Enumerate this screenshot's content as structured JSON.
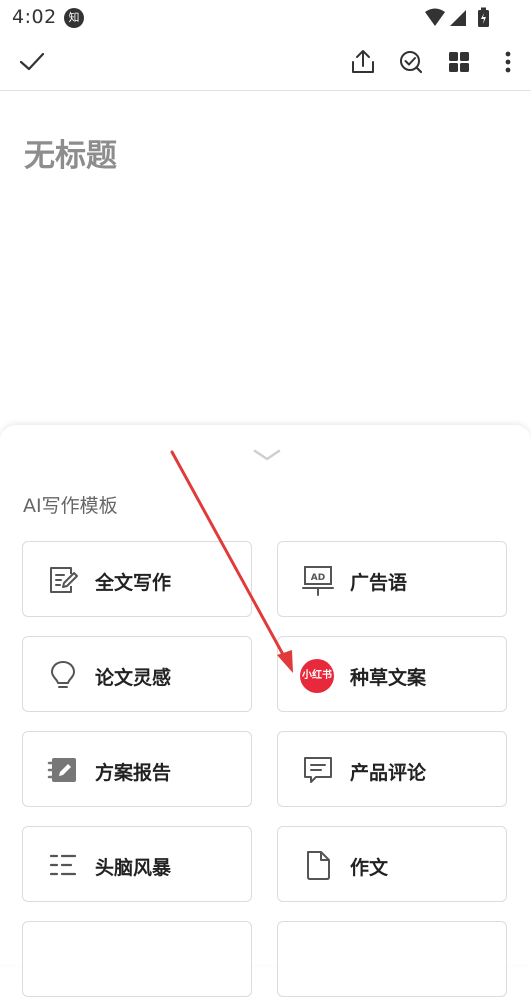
{
  "status_bar": {
    "time": "4:02",
    "notification_badge": "知"
  },
  "toolbar": {
    "icons": [
      "check-icon",
      "share-icon",
      "task-check-icon",
      "grid-icon",
      "more-vert-icon"
    ]
  },
  "editor": {
    "title_placeholder": "无标题"
  },
  "templates_panel": {
    "section_title": "AI写作模板",
    "cards": [
      {
        "label": "全文写作",
        "icon": "edit-document-icon"
      },
      {
        "label": "广告语",
        "icon": "ad-board-icon"
      },
      {
        "label": "论文灵感",
        "icon": "lightbulb-icon"
      },
      {
        "label": "种草文案",
        "icon": "xiaohongshu-logo",
        "logo_text": "小红书"
      },
      {
        "label": "方案报告",
        "icon": "report-icon"
      },
      {
        "label": "产品评论",
        "icon": "comment-icon"
      },
      {
        "label": "头脑风暴",
        "icon": "list-icon"
      },
      {
        "label": "作文",
        "icon": "page-icon"
      }
    ]
  },
  "colors": {
    "xiaohongshu_red": "#e8283b",
    "annotation_arrow": "#e03a3a"
  }
}
